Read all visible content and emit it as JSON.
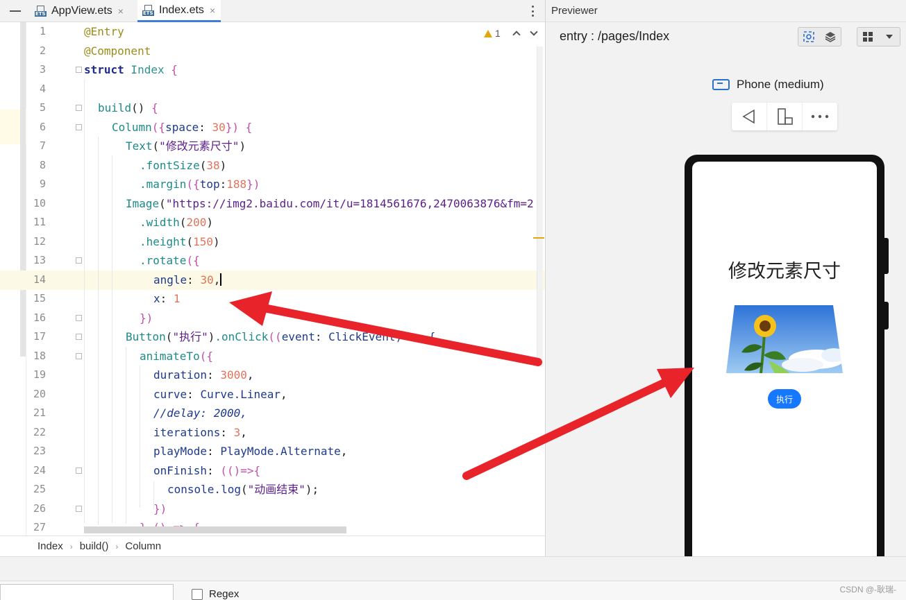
{
  "tabs": [
    {
      "label": "AppView.ets",
      "icon": "ets-file-icon",
      "active": false
    },
    {
      "label": "Index.ets",
      "icon": "ets-file-icon",
      "active": true
    }
  ],
  "tab_icon_text": "ETS",
  "close_glyph": "×",
  "editor": {
    "warning_count": "1",
    "line_numbers": [
      "1",
      "2",
      "3",
      "4",
      "5",
      "6",
      "7",
      "8",
      "9",
      "10",
      "11",
      "12",
      "13",
      "14",
      "15",
      "16",
      "17",
      "18",
      "19",
      "20",
      "21",
      "22",
      "23",
      "24",
      "25",
      "26",
      "27"
    ],
    "lines": {
      "l1": "@Entry",
      "l2": "@Component",
      "l3_kw": "struct",
      "l3_name": " Index ",
      "l3_brace": "{",
      "l5_fn": "build",
      "l5_rest": "() ",
      "l5_brace": "{",
      "l6_fn": "Column",
      "l6_a": "({",
      "l6_prop": "space",
      "l6_colon": ": ",
      "l6_num": "30",
      "l6_b": "}) ",
      "l6_brace": "{",
      "l7_fn": "Text",
      "l7_a": "(",
      "l7_str": "\"修改元素尺寸\"",
      "l7_b": ")",
      "l8_fn": ".fontSize",
      "l8_a": "(",
      "l8_num": "38",
      "l8_b": ")",
      "l9_fn": ".margin",
      "l9_a": "({",
      "l9_prop": "top",
      "l9_colon": ":",
      "l9_num": "188",
      "l9_b": "})",
      "l10_fn": "Image",
      "l10_a": "(",
      "l10_str": "\"https://img2.baidu.com/it/u=1814561676,2470063876&fm=2",
      "l11_fn": ".width",
      "l11_a": "(",
      "l11_num": "200",
      "l11_b": ")",
      "l12_fn": ".height",
      "l12_a": "(",
      "l12_num": "150",
      "l12_b": ")",
      "l13_fn": ".rotate",
      "l13_a": "({",
      "l14_prop": "angle",
      "l14_colon": ": ",
      "l14_num": "30",
      "l14_b": ",",
      "l15_prop": "x",
      "l15_colon": ": ",
      "l15_num": "1",
      "l16": "})",
      "l17_fn": "Button",
      "l17_a": "(",
      "l17_str": "\"执行\"",
      "l17_b": ")",
      "l17_fn2": ".onClick",
      "l17_c": "((",
      "l17_param": "event",
      "l17_colon": ": ",
      "l17_type": "ClickEvent) => {",
      "l18_fn": "animateTo",
      "l18_a": "({",
      "l19_prop": "duration",
      "l19_colon": ": ",
      "l19_num": "3000",
      "l19_b": ",",
      "l20_prop": "curve",
      "l20_colon": ": ",
      "l20_val": "Curve.Linear",
      "l20_b": ",",
      "l21_comment": "//delay: 2000,",
      "l22_prop": "iterations",
      "l22_colon": ": ",
      "l22_num": "3",
      "l22_b": ",",
      "l23_prop": "playMode",
      "l23_colon": ": ",
      "l23_val": "PlayMode.Alternate",
      "l23_b": ",",
      "l24_prop": "onFinish",
      "l24_colon": ": ",
      "l24_val": "(()=>{",
      "l25_fn": "console.log",
      "l25_a": "(",
      "l25_str": "\"动画结束\"",
      "l25_b": ");",
      "l26": "})",
      "l27": "},() => {"
    }
  },
  "breadcrumb": [
    "Index",
    "build()",
    "Column"
  ],
  "breadcrumb_sep": "›",
  "findbar": {
    "regex_label": "Regex"
  },
  "watermark": "CSDN @-耿瑞-",
  "previewer": {
    "title": "Previewer",
    "route": "entry : /pages/Index",
    "device": "Phone (medium)",
    "app": {
      "title": "修改元素尺寸",
      "button": "执行"
    }
  },
  "colors": {
    "accent": "#3f7ed6",
    "app_button": "#1677ff",
    "arrow": "#e8232a",
    "warning": "#e2a70a"
  }
}
